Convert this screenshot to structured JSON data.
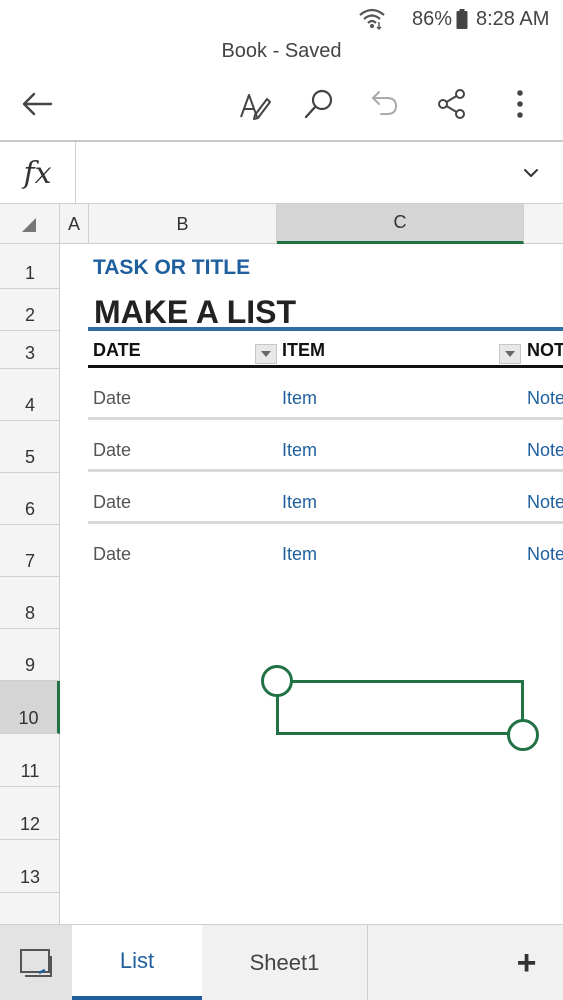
{
  "status_bar": {
    "battery_percent": "86%",
    "time": "8:28 AM",
    "icons": [
      "wifi-icon",
      "battery-icon"
    ]
  },
  "title": "Book - Saved",
  "toolbar": {
    "icons": [
      "back-arrow-icon",
      "edit-pen-icon",
      "search-icon",
      "undo-icon",
      "share-icon",
      "more-vertical-icon"
    ]
  },
  "formula_bar": {
    "fx_label": "fx",
    "value": "",
    "icons": [
      "chevron-down-icon"
    ]
  },
  "columns": [
    {
      "label": "A",
      "selected": false
    },
    {
      "label": "B",
      "selected": false
    },
    {
      "label": "C",
      "selected": true
    }
  ],
  "rows": [
    "1",
    "2",
    "3",
    "4",
    "5",
    "6",
    "7",
    "8",
    "9",
    "10",
    "11",
    "12",
    "13"
  ],
  "selected_row": "10",
  "sheet": {
    "task_title": "TASK OR TITLE",
    "list_title": "MAKE A LIST",
    "headers": [
      "DATE",
      "ITEM",
      "NOT"
    ],
    "rows": [
      [
        "Date",
        "Item",
        "Note"
      ],
      [
        "Date",
        "Item",
        "Note"
      ],
      [
        "Date",
        "Item",
        "Note"
      ],
      [
        "Date",
        "Item",
        "Note"
      ]
    ]
  },
  "tabs": [
    {
      "label": "List",
      "active": true
    },
    {
      "label": "Sheet1",
      "active": false
    }
  ],
  "add_sheet_label": "+",
  "colors": {
    "accent_green": "#217346",
    "accent_blue": "#1f5f9e"
  }
}
